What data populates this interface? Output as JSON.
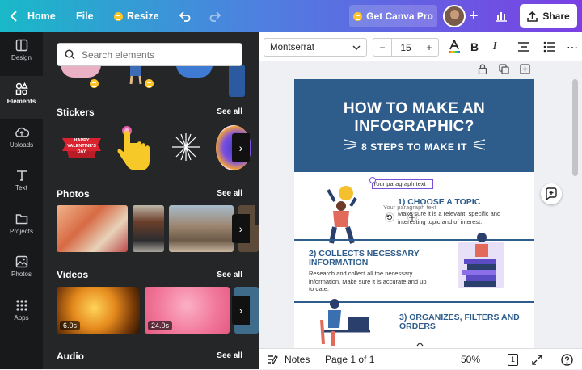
{
  "topbar": {
    "home": "Home",
    "file": "File",
    "resize": "Resize",
    "pro": "Get Canva Pro",
    "share": "Share"
  },
  "rail": [
    {
      "label": "Design",
      "icon": "layout-icon"
    },
    {
      "label": "Elements",
      "icon": "shapes-icon"
    },
    {
      "label": "Uploads",
      "icon": "cloud-upload-icon"
    },
    {
      "label": "Text",
      "icon": "text-icon"
    },
    {
      "label": "Projects",
      "icon": "folder-icon"
    },
    {
      "label": "Photos",
      "icon": "image-icon"
    },
    {
      "label": "Apps",
      "icon": "grid-icon"
    }
  ],
  "panel": {
    "search_placeholder": "Search elements",
    "sections": {
      "stickers": "Stickers",
      "photos": "Photos",
      "videos": "Videos",
      "audio": "Audio"
    },
    "see_all": "See all",
    "sticker_text": "HAPPY VALENTINE'S DAY",
    "video_durations": [
      "6.0s",
      "24.0s"
    ]
  },
  "toolbar": {
    "font": "Montserrat",
    "size": "15",
    "minus": "−",
    "plus": "+"
  },
  "infographic": {
    "title1": "HOW TO MAKE AN",
    "title2": "INFOGRAPHIC?",
    "subtitle": "8 STEPS TO MAKE IT",
    "placeholder": "Your paragraph text",
    "placeholder_ghost": "Your paragraph text",
    "step1_title": "1) CHOOSE A TOPIC",
    "step1_text": "Make sure it is a relevant, specific and interesting topic and of interest.",
    "step2_title": "2) COLLECTS NECESSARY INFORMATION",
    "step2_text": "Research and collect all the necessary information. Make sure it is accurate and up to date.",
    "step3_title": "3) ORGANIZES, FILTERS AND ORDERS"
  },
  "bottombar": {
    "notes": "Notes",
    "page": "Page 1 of 1",
    "zoom": "50%",
    "page_count": "1"
  },
  "colors": {
    "accent": "#7b3fe4",
    "header_blue": "#2e5c8b",
    "panel_bg": "#252627",
    "rail_bg": "#18191b"
  }
}
